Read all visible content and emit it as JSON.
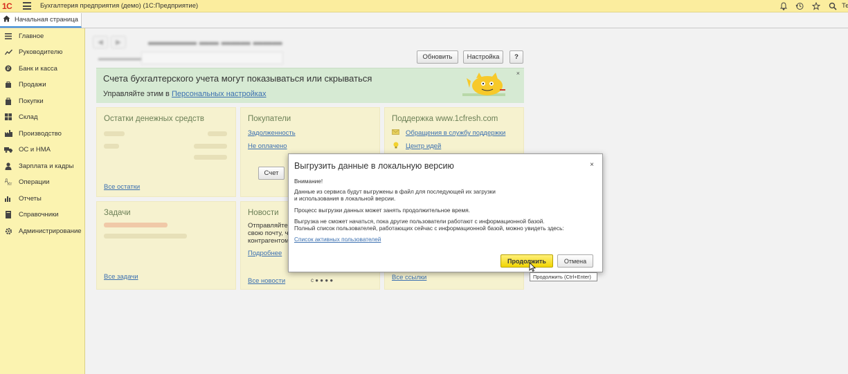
{
  "titlebar": {
    "logo": "1С",
    "app_title": "Бухгалтерия предприятия (демо)  (1С:Предприятие)",
    "user_initial": "Те",
    "icons": [
      "bell-icon",
      "history-icon",
      "star-icon",
      "search-icon"
    ]
  },
  "tabs": {
    "home_label": "Начальная страница"
  },
  "sidebar": {
    "items": [
      {
        "label": "Главное",
        "icon": "menu-icon"
      },
      {
        "label": "Руководителю",
        "icon": "chart-line-icon"
      },
      {
        "label": "Банк и касса",
        "icon": "coin-icon"
      },
      {
        "label": "Продажи",
        "icon": "bag-icon"
      },
      {
        "label": "Покупки",
        "icon": "cart-icon"
      },
      {
        "label": "Склад",
        "icon": "warehouse-icon"
      },
      {
        "label": "Производство",
        "icon": "factory-icon"
      },
      {
        "label": "ОС и НМА",
        "icon": "truck-icon"
      },
      {
        "label": "Зарплата и кадры",
        "icon": "person-icon"
      },
      {
        "label": "Операции",
        "icon": "operations-icon"
      },
      {
        "label": "Отчеты",
        "icon": "bar-chart-icon"
      },
      {
        "label": "Справочники",
        "icon": "book-icon"
      },
      {
        "label": "Администрирование",
        "icon": "gear-icon"
      }
    ]
  },
  "toolbar": {
    "refresh_label": "Обновить",
    "settings_label": "Настройка",
    "help_label": "?"
  },
  "banner": {
    "title": "Счета бухгалтерского учета могут показываться или скрываться",
    "sub_prefix": "Управляйте этим в ",
    "sub_link": "Персональных настройках",
    "close": "×"
  },
  "panels": {
    "cash": {
      "title": "Остатки денежных средств",
      "link": "Все остатки"
    },
    "buyers": {
      "title": "Покупатели",
      "link1": "Задолженность",
      "link2": "Не оплачено",
      "button": "Счет"
    },
    "support": {
      "title": "Поддержка www.1cfresh.com",
      "link1": "Обращения в службу поддержки",
      "link2": "Центр идей"
    },
    "tasks": {
      "title": "Задачи",
      "link": "Все задачи"
    },
    "news": {
      "title": "Новости",
      "text_lines": [
        "Отправляйте",
        "свою почту, чт",
        "контрагентом"
      ],
      "more": "Подробнее",
      "link": "Все новости",
      "pager": "c  ●  ●  ●  ●"
    },
    "links": {
      "link": "Все ссылки"
    }
  },
  "dialog": {
    "title": "Выгрузить данные в локальную версию",
    "close": "×",
    "attention": "Внимание!",
    "line1": "Данные из сервиса будут выгружены в файл для последующей их загрузки",
    "line2": "и использования в локальной версии.",
    "line3": "Процесс выгрузки данных может занять продолжительное время.",
    "line4": "Выгрузка не сможет начаться, пока другие пользователи работают с информационной базой.",
    "line5": "Полный список пользователей, работающих сейчас с информационной базой, можно увидеть здесь:",
    "link": "Список активных пользователей",
    "continue_label": "Продолжить",
    "cancel_label": "Отмена",
    "tooltip": "Продолжить (Ctrl+Enter)"
  }
}
